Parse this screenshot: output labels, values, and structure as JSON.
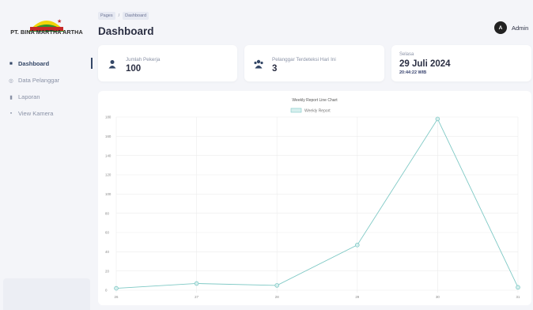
{
  "brand": {
    "name": "PT. BINA MARTHA ARTHA"
  },
  "sidebar": {
    "items": [
      {
        "label": "Dashboard",
        "icon": "home-icon",
        "active": true
      },
      {
        "label": "Data Pelanggar",
        "icon": "database-icon",
        "active": false
      },
      {
        "label": "Laporan",
        "icon": "bar-chart-icon",
        "active": false
      },
      {
        "label": "View Kamera",
        "icon": "camera-icon",
        "active": false
      }
    ]
  },
  "header": {
    "breadcrumb": [
      "Pages",
      "Dashboard"
    ],
    "title": "Dashboard",
    "user": {
      "initial": "A",
      "name": "Admin"
    }
  },
  "stats": [
    {
      "label": "Jumlah Pekerja",
      "value": "100",
      "icon": "user-icon"
    },
    {
      "label": "Pelanggar Terdeteksi Hari Ini",
      "value": "3",
      "icon": "users-icon"
    }
  ],
  "date_card": {
    "day": "Selasa",
    "date": "29 Juli 2024",
    "time": "20:44:22 WIB"
  },
  "colors": {
    "line": "#7fc9c5",
    "fill": "#d7efee",
    "text": "#344767",
    "accent": "#344767"
  },
  "chart_data": {
    "type": "line",
    "title": "Weekly Report Line Chart",
    "legend": "top",
    "grid": true,
    "x": [
      "26",
      "27",
      "28",
      "29",
      "30",
      "31"
    ],
    "y_ticks": [
      0,
      20,
      40,
      60,
      80,
      100,
      120,
      140,
      160,
      180
    ],
    "ylim": [
      0,
      180
    ],
    "series": [
      {
        "name": "Weekly Report",
        "values": [
          2,
          7,
          5,
          47,
          178,
          3
        ]
      }
    ]
  }
}
